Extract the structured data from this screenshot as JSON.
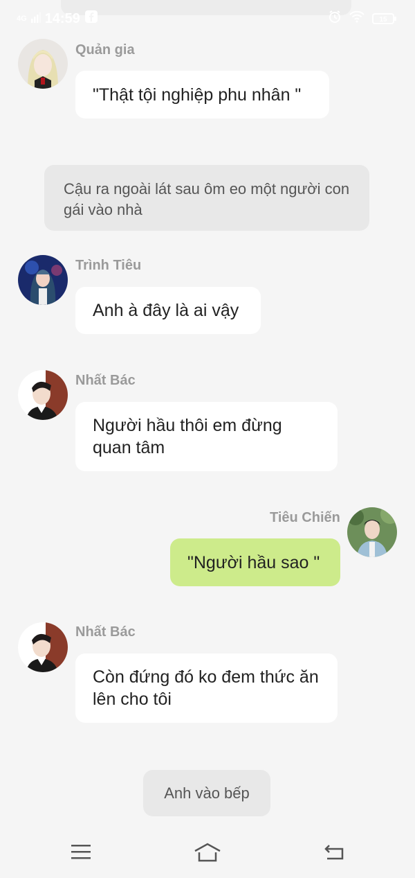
{
  "status_bar": {
    "network": "4G",
    "time": "14:59",
    "battery": "15"
  },
  "messages": [
    {
      "id": "m1",
      "sender": "Quản gia",
      "text": "\"Thật tội nghiệp phu nhân \"",
      "side": "left"
    },
    {
      "id": "n1",
      "type": "narration",
      "text": "Cậu ra ngoài lát sau ôm eo một người con gái vào nhà"
    },
    {
      "id": "m2",
      "sender": "Trình Tiêu",
      "text": "Anh à đây là ai vậy",
      "side": "left"
    },
    {
      "id": "m3",
      "sender": "Nhất Bác",
      "text": "Người hầu thôi em đừng quan tâm",
      "side": "left"
    },
    {
      "id": "m4",
      "sender": "Tiêu Chiến",
      "text": "\"Người hầu sao \"",
      "side": "right"
    },
    {
      "id": "m5",
      "sender": "Nhất Bác",
      "text": "Còn đứng đó ko đem thức ăn lên cho tôi",
      "side": "left"
    },
    {
      "id": "a1",
      "type": "action",
      "text": "Anh vào bếp"
    }
  ],
  "colors": {
    "background": "#f5f5f5",
    "bubble_self": "#cdeb8b",
    "bubble_other": "#ffffff",
    "narration_bg": "#e8e8e8",
    "name_text": "#9a9a9a"
  },
  "icons": [
    "menu-icon",
    "home-icon",
    "back-icon",
    "alarm-icon",
    "wifi-icon",
    "battery-icon",
    "facebook-icon",
    "signal-icon"
  ]
}
